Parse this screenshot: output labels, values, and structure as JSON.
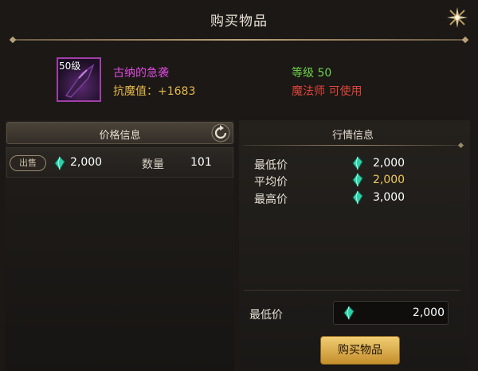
{
  "window": {
    "title": "购买物品"
  },
  "item": {
    "level_badge": "50级",
    "name": "古纳的急袭",
    "stat": "抗魔值：+1683",
    "required_level": "等级 50",
    "class_restriction": "魔法师 可使用"
  },
  "price_panel": {
    "header": "价格信息",
    "listings": [
      {
        "action": "出售",
        "price": "2,000",
        "quantity_label": "数量",
        "quantity": "101"
      }
    ]
  },
  "market_panel": {
    "title": "行情信息",
    "stats": [
      {
        "label": "最低价",
        "value": "2,000",
        "color": "#ffffff"
      },
      {
        "label": "平均价",
        "value": "2,000",
        "color": "#f0c95a"
      },
      {
        "label": "最高价",
        "value": "3,000",
        "color": "#ffffff"
      }
    ],
    "bid_label": "最低价",
    "bid_value": "2,000",
    "buy_button": "购买物品"
  },
  "colors": {
    "item_name": "#df4bdf",
    "item_stat": "#e6b84a",
    "required_level": "#6fd34a",
    "class_restriction": "#e0453a",
    "gem": "#2fd1a8",
    "buy_button": "#e3b34e"
  },
  "icons": {
    "close": "sparkle-close-icon",
    "refresh": "refresh-icon",
    "currency": "gem-icon"
  }
}
